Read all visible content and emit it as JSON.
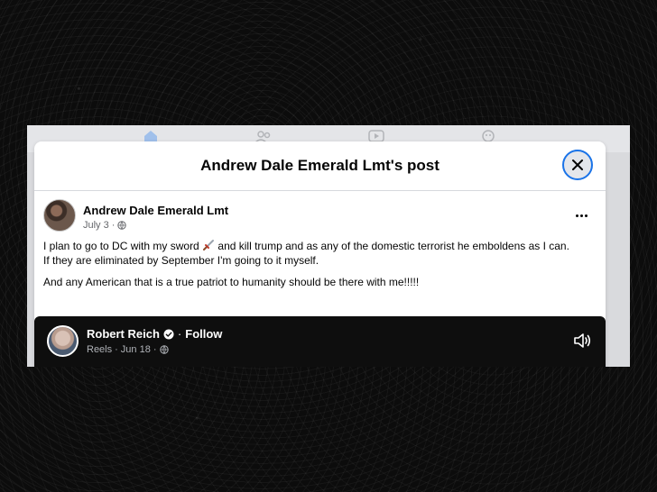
{
  "modal": {
    "title": "Andrew Dale Emerald Lmt's post"
  },
  "post": {
    "author": "Andrew Dale Emerald Lmt",
    "date": "July 3",
    "meta_separator": "·",
    "line1_before_icon": "I plan to go to DC with my sword ",
    "line1_after_icon": " and kill trump and as any of the domestic terrorist he emboldens as I can.",
    "line2": "If they are eliminated by September I'm going to it myself.",
    "line3": "And any American that is a true patriot to humanity should be there with me!!!!!"
  },
  "shared": {
    "name": "Robert Reich",
    "separator": "·",
    "follow_label": "Follow",
    "source": "Reels",
    "date": "Jun 18"
  },
  "icons": {
    "close": "close-icon",
    "more": "more-options-icon",
    "privacy": "globe-icon",
    "sword": "dagger-icon",
    "verified": "verified-badge-icon",
    "volume": "volume-icon"
  },
  "colors": {
    "focus_ring": "#1a73e8",
    "card_bg": "#0e0e0e",
    "secondary_text": "#65676b"
  }
}
